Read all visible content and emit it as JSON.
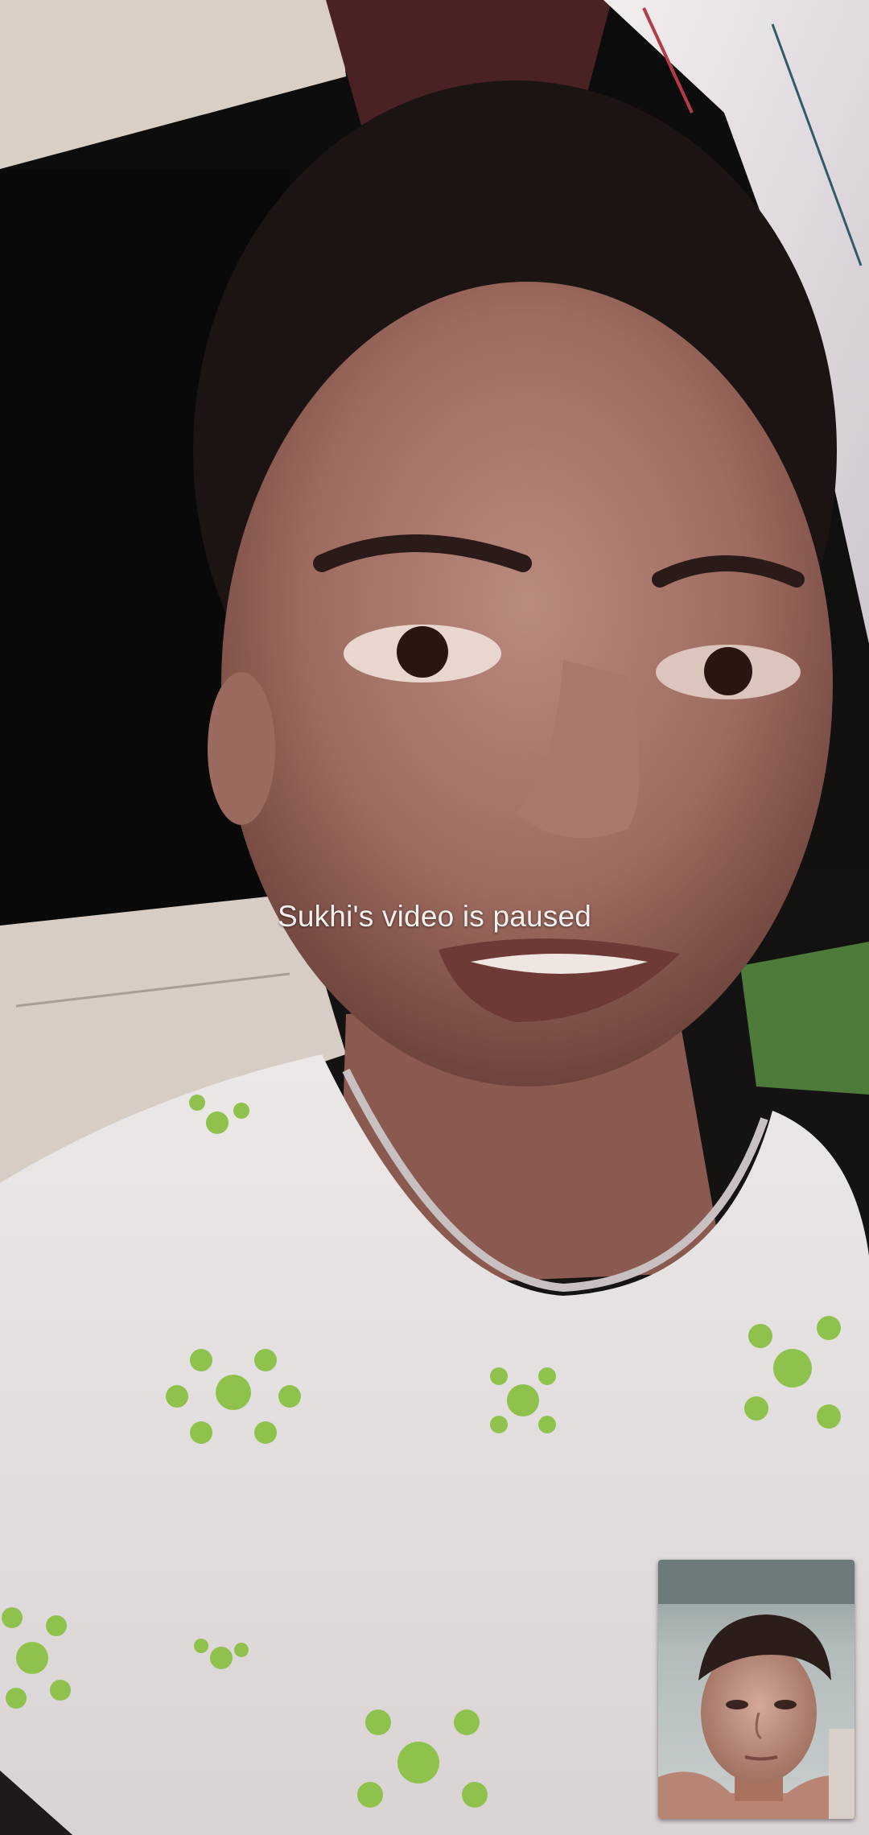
{
  "call": {
    "paused_message": "Sukhi's video is paused"
  },
  "remote_participant": {
    "name": "Sukhi",
    "video_state": "paused"
  },
  "self_view": {
    "video_state": "on"
  }
}
